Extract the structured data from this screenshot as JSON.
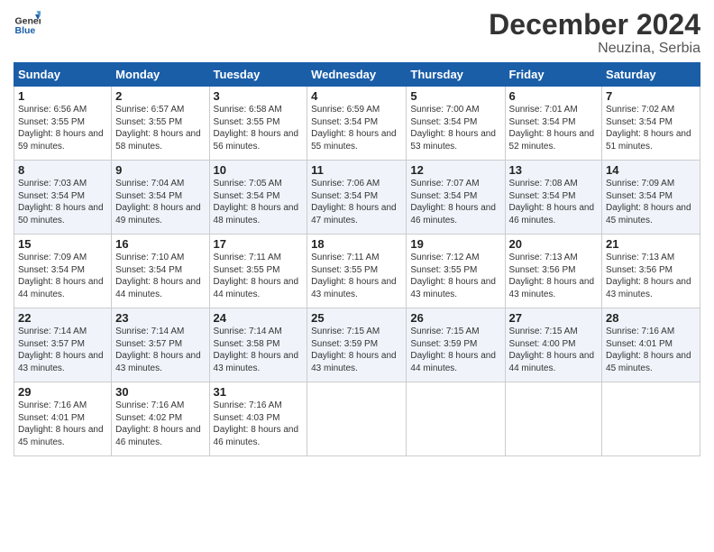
{
  "header": {
    "logo_line1": "General",
    "logo_line2": "Blue",
    "month_title": "December 2024",
    "subtitle": "Neuzina, Serbia"
  },
  "weekdays": [
    "Sunday",
    "Monday",
    "Tuesday",
    "Wednesday",
    "Thursday",
    "Friday",
    "Saturday"
  ],
  "weeks": [
    [
      {
        "day": "1",
        "rise": "6:56 AM",
        "set": "3:55 PM",
        "daylight": "8 hours and 59 minutes."
      },
      {
        "day": "2",
        "rise": "6:57 AM",
        "set": "3:55 PM",
        "daylight": "8 hours and 58 minutes."
      },
      {
        "day": "3",
        "rise": "6:58 AM",
        "set": "3:55 PM",
        "daylight": "8 hours and 56 minutes."
      },
      {
        "day": "4",
        "rise": "6:59 AM",
        "set": "3:54 PM",
        "daylight": "8 hours and 55 minutes."
      },
      {
        "day": "5",
        "rise": "7:00 AM",
        "set": "3:54 PM",
        "daylight": "8 hours and 53 minutes."
      },
      {
        "day": "6",
        "rise": "7:01 AM",
        "set": "3:54 PM",
        "daylight": "8 hours and 52 minutes."
      },
      {
        "day": "7",
        "rise": "7:02 AM",
        "set": "3:54 PM",
        "daylight": "8 hours and 51 minutes."
      }
    ],
    [
      {
        "day": "8",
        "rise": "7:03 AM",
        "set": "3:54 PM",
        "daylight": "8 hours and 50 minutes."
      },
      {
        "day": "9",
        "rise": "7:04 AM",
        "set": "3:54 PM",
        "daylight": "8 hours and 49 minutes."
      },
      {
        "day": "10",
        "rise": "7:05 AM",
        "set": "3:54 PM",
        "daylight": "8 hours and 48 minutes."
      },
      {
        "day": "11",
        "rise": "7:06 AM",
        "set": "3:54 PM",
        "daylight": "8 hours and 47 minutes."
      },
      {
        "day": "12",
        "rise": "7:07 AM",
        "set": "3:54 PM",
        "daylight": "8 hours and 46 minutes."
      },
      {
        "day": "13",
        "rise": "7:08 AM",
        "set": "3:54 PM",
        "daylight": "8 hours and 46 minutes."
      },
      {
        "day": "14",
        "rise": "7:09 AM",
        "set": "3:54 PM",
        "daylight": "8 hours and 45 minutes."
      }
    ],
    [
      {
        "day": "15",
        "rise": "7:09 AM",
        "set": "3:54 PM",
        "daylight": "8 hours and 44 minutes."
      },
      {
        "day": "16",
        "rise": "7:10 AM",
        "set": "3:54 PM",
        "daylight": "8 hours and 44 minutes."
      },
      {
        "day": "17",
        "rise": "7:11 AM",
        "set": "3:55 PM",
        "daylight": "8 hours and 44 minutes."
      },
      {
        "day": "18",
        "rise": "7:11 AM",
        "set": "3:55 PM",
        "daylight": "8 hours and 43 minutes."
      },
      {
        "day": "19",
        "rise": "7:12 AM",
        "set": "3:55 PM",
        "daylight": "8 hours and 43 minutes."
      },
      {
        "day": "20",
        "rise": "7:13 AM",
        "set": "3:56 PM",
        "daylight": "8 hours and 43 minutes."
      },
      {
        "day": "21",
        "rise": "7:13 AM",
        "set": "3:56 PM",
        "daylight": "8 hours and 43 minutes."
      }
    ],
    [
      {
        "day": "22",
        "rise": "7:14 AM",
        "set": "3:57 PM",
        "daylight": "8 hours and 43 minutes."
      },
      {
        "day": "23",
        "rise": "7:14 AM",
        "set": "3:57 PM",
        "daylight": "8 hours and 43 minutes."
      },
      {
        "day": "24",
        "rise": "7:14 AM",
        "set": "3:58 PM",
        "daylight": "8 hours and 43 minutes."
      },
      {
        "day": "25",
        "rise": "7:15 AM",
        "set": "3:59 PM",
        "daylight": "8 hours and 43 minutes."
      },
      {
        "day": "26",
        "rise": "7:15 AM",
        "set": "3:59 PM",
        "daylight": "8 hours and 44 minutes."
      },
      {
        "day": "27",
        "rise": "7:15 AM",
        "set": "4:00 PM",
        "daylight": "8 hours and 44 minutes."
      },
      {
        "day": "28",
        "rise": "7:16 AM",
        "set": "4:01 PM",
        "daylight": "8 hours and 45 minutes."
      }
    ],
    [
      {
        "day": "29",
        "rise": "7:16 AM",
        "set": "4:01 PM",
        "daylight": "8 hours and 45 minutes."
      },
      {
        "day": "30",
        "rise": "7:16 AM",
        "set": "4:02 PM",
        "daylight": "8 hours and 46 minutes."
      },
      {
        "day": "31",
        "rise": "7:16 AM",
        "set": "4:03 PM",
        "daylight": "8 hours and 46 minutes."
      },
      null,
      null,
      null,
      null
    ]
  ]
}
